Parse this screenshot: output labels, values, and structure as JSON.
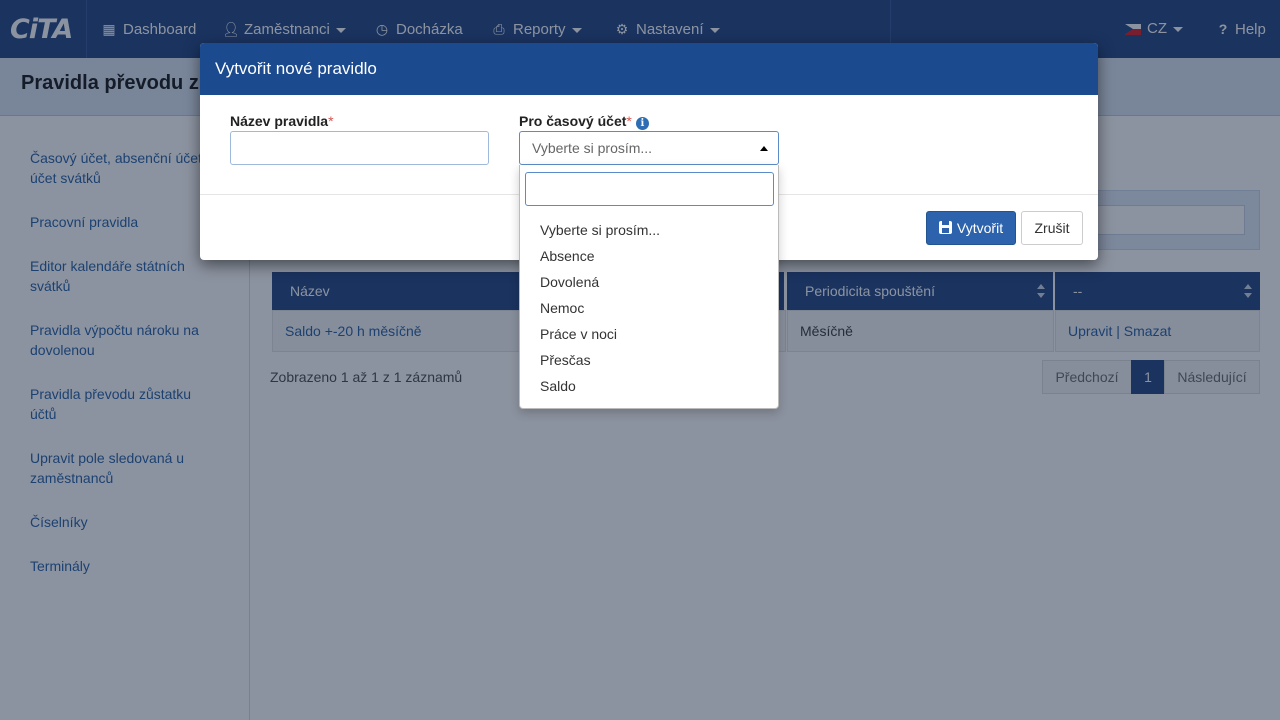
{
  "app": {
    "logo": "CiTA"
  },
  "nav": {
    "items": [
      {
        "label": "Dashboard",
        "icon": "grid-icon",
        "dropdown": false
      },
      {
        "label": "Zaměstnanci",
        "icon": "user-icon",
        "dropdown": true
      },
      {
        "label": "Docházka",
        "icon": "clock-icon",
        "dropdown": false
      },
      {
        "label": "Reporty",
        "icon": "printer-icon",
        "dropdown": true
      },
      {
        "label": "Nastavení",
        "icon": "gear-icon",
        "dropdown": true
      }
    ],
    "language": "CZ",
    "help": "Help"
  },
  "page": {
    "title": "Pravidla převodu z"
  },
  "sidebar": {
    "items": [
      {
        "label": "Časový účet, absenční účet, účet svátků"
      },
      {
        "label": "Pracovní pravidla"
      },
      {
        "label": "Editor kalendáře státních svátků"
      },
      {
        "label": "Pravidla výpočtu nároku na dovolenou"
      },
      {
        "label": "Pravidla převodu zůstatku účtů"
      },
      {
        "label": "Upravit pole sledovaná u zaměstnanců"
      },
      {
        "label": "Číselníky"
      },
      {
        "label": "Terminály"
      }
    ]
  },
  "table": {
    "headers": [
      "Název",
      "Periodicita spouštění",
      "--"
    ],
    "row": {
      "name": "Saldo +-20 h měsíčně",
      "period": "Měsíčně",
      "edit": "Upravit",
      "separator": "|",
      "delete": "Smazat"
    },
    "info": "Zobrazeno 1 až 1 z 1 záznamů",
    "pager": {
      "prev": "Předchozí",
      "current": "1",
      "next": "Následující"
    }
  },
  "modal": {
    "title": "Vytvořit nové pravidlo",
    "name_label": "Název pravidla",
    "name_value": "",
    "account_label": "Pro časový účet",
    "required_mark": "*",
    "info_glyph": "i",
    "select_placeholder": "Vyberte si prosím...",
    "create_button": "Vytvořit",
    "cancel_button": "Zrušit"
  },
  "dropdown": {
    "search_value": "",
    "options": [
      "Vyberte si prosím...",
      "Absence",
      "Dovolená",
      "Nemoc",
      "Práce v noci",
      "Přesčas",
      "Saldo"
    ]
  },
  "colors": {
    "navbar": "#1b3f7d",
    "modal_header": "#1b4a8f",
    "primary": "#2d63ad",
    "link": "#1f5aa0"
  }
}
